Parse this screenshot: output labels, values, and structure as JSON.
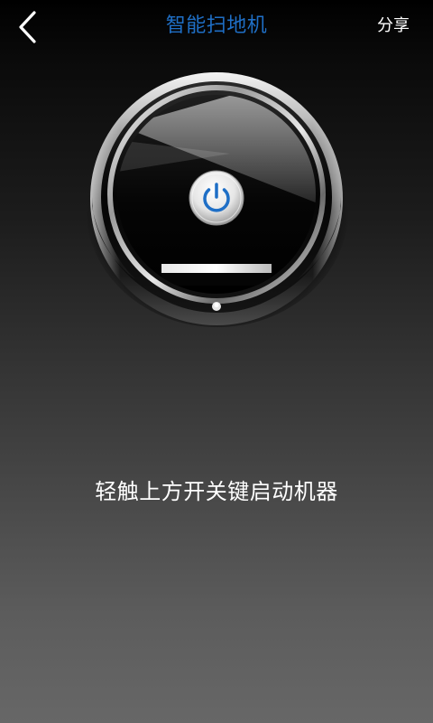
{
  "header": {
    "back_icon": "chevron-left-icon",
    "title": "智能扫地机",
    "share_label": "分享"
  },
  "device": {
    "name": "robot-vacuum",
    "power_icon": "power-icon",
    "accent_color": "#1f6fc6"
  },
  "hint": {
    "text": "轻触上方开关键启动机器"
  },
  "colors": {
    "title": "#1f6fc6",
    "text": "#ffffff",
    "background_top": "#000000",
    "background_bottom": "#676767"
  }
}
